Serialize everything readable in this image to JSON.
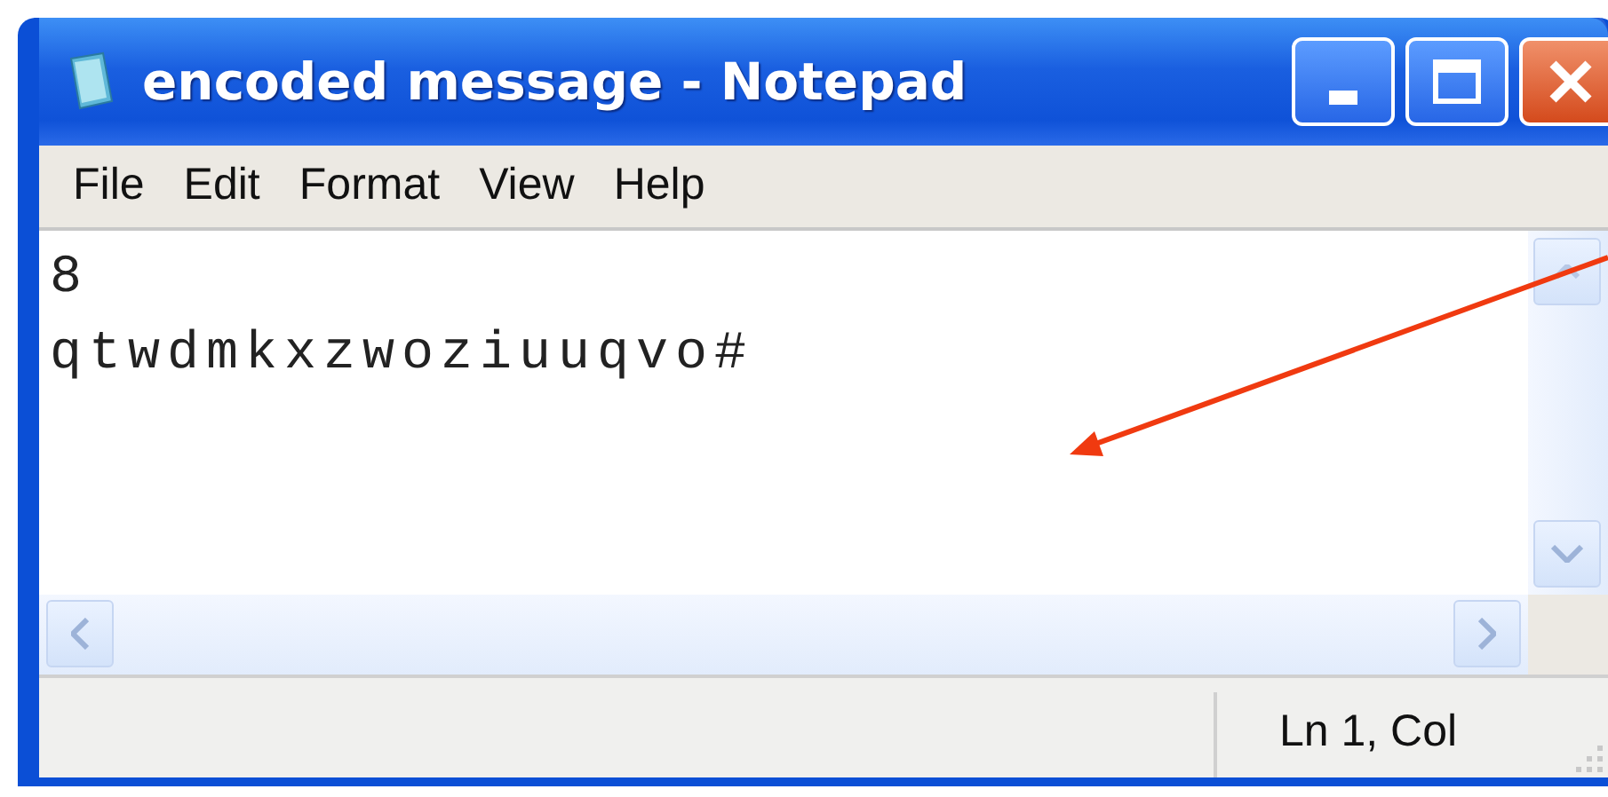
{
  "window": {
    "title": "encoded message - Notepad"
  },
  "title_buttons": [
    {
      "kind": "minimize"
    },
    {
      "kind": "maximize"
    },
    {
      "kind": "close"
    }
  ],
  "menu": [
    {
      "label": "File"
    },
    {
      "label": "Edit"
    },
    {
      "label": "Format"
    },
    {
      "label": "View"
    },
    {
      "label": "Help"
    }
  ],
  "document": {
    "lines": [
      "8",
      "qtwdmkxzwoziuuqvo#"
    ]
  },
  "status_bar": {
    "position": "Ln 1, Col"
  },
  "annotation": {
    "kind": "arrow"
  }
}
